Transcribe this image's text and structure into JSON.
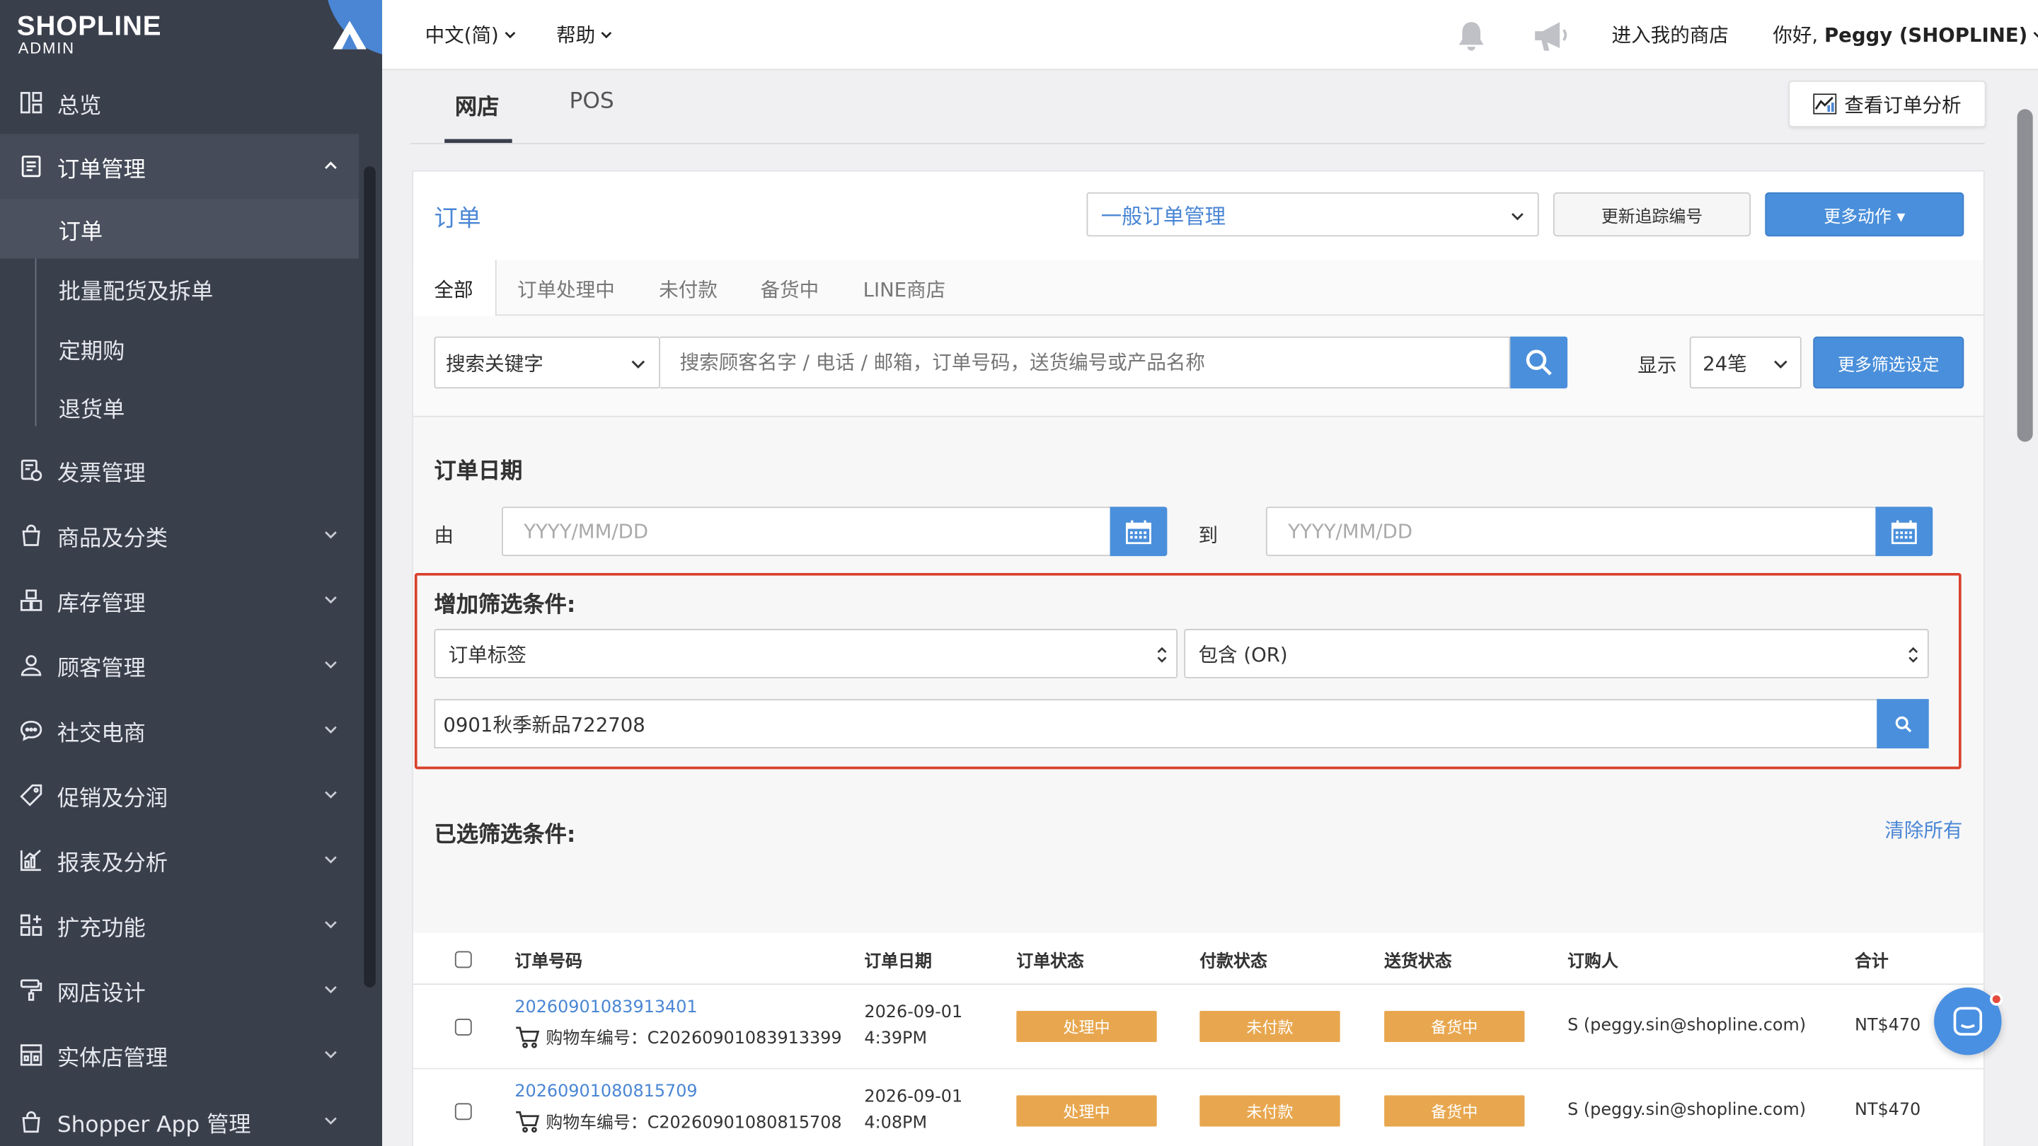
{
  "brand": {
    "logo_main": "SHOPLINE",
    "logo_sub": "ADMIN"
  },
  "sidebar": {
    "items": [
      {
        "label": "总览",
        "icon": "dashboard-icon"
      },
      {
        "label": "订单管理",
        "icon": "orders-icon",
        "expanded": true
      },
      {
        "label": "发票管理",
        "icon": "invoice-icon"
      },
      {
        "label": "商品及分类",
        "icon": "bag-icon"
      },
      {
        "label": "库存管理",
        "icon": "inventory-icon"
      },
      {
        "label": "顾客管理",
        "icon": "user-icon"
      },
      {
        "label": "社交电商",
        "icon": "chat-bubble-icon"
      },
      {
        "label": "促销及分润",
        "icon": "tag-icon"
      },
      {
        "label": "报表及分析",
        "icon": "chart-icon"
      },
      {
        "label": "扩充功能",
        "icon": "apps-icon"
      },
      {
        "label": "网店设计",
        "icon": "paint-icon"
      },
      {
        "label": "实体店管理",
        "icon": "store-icon"
      },
      {
        "label": "Shopper App 管理",
        "icon": "mobile-icon"
      }
    ],
    "sub_items": [
      {
        "label": "订单",
        "active": true
      },
      {
        "label": "批量配货及拆单"
      },
      {
        "label": "定期购"
      },
      {
        "label": "退货单"
      }
    ]
  },
  "topbar": {
    "language": "中文(简)",
    "help": "帮助",
    "enter_store": "进入我的商店",
    "greeting_prefix": "你好, ",
    "user_name": "Peggy (SHOPLINE)"
  },
  "page_tabs": [
    {
      "label": "网店",
      "active": true
    },
    {
      "label": "POS"
    }
  ],
  "analysis_button": "查看订单分析",
  "orders_panel": {
    "title": "订单",
    "management_select": "一般订单管理",
    "update_tracking_button": "更新追踪编号",
    "more_actions_button": "更多动作 ▾",
    "status_tabs": [
      "全部",
      "订单处理中",
      "未付款",
      "备货中",
      "LINE商店"
    ],
    "search": {
      "type_select": "搜索关键字",
      "placeholder": "搜索顾客名字 / 电话 / 邮箱，订单号码，送货编号或产品名称",
      "display_label": "显示",
      "per_page": "24笔",
      "more_filters_button": "更多筛选设定"
    },
    "date_filter": {
      "title": "订单日期",
      "from_label": "由",
      "to_label": "到",
      "from_placeholder": "YYYY/MM/DD",
      "to_placeholder": "YYYY/MM/DD"
    },
    "add_filter": {
      "title": "增加筛选条件:",
      "field_select": "订单标签",
      "operator_select": "包含 (OR)",
      "value": "0901秋季新品722708"
    },
    "chosen_filters": {
      "title": "已选筛选条件:",
      "clear_all": "清除所有"
    },
    "table": {
      "headers": [
        "订单号码",
        "订单日期",
        "订单状态",
        "付款状态",
        "送货状态",
        "订购人",
        "合计"
      ],
      "rows": [
        {
          "order_no": "20260901083913401",
          "cart_label": "购物车编号：C20260901083913399",
          "date": "2026-09-01",
          "time": "4:39PM",
          "order_status": "处理中",
          "payment_status": "未付款",
          "delivery_status": "备货中",
          "customer": "S (peggy.sin@shopline.com)",
          "total": "NT$470"
        },
        {
          "order_no": "20260901080815709",
          "cart_label": "购物车编号：C20260901080815708",
          "date": "2026-09-01",
          "time": "4:08PM",
          "order_status": "处理中",
          "payment_status": "未付款",
          "delivery_status": "备货中",
          "customer": "S (peggy.sin@shopline.com)",
          "total": "NT$470"
        }
      ]
    }
  },
  "colors": {
    "sidebar_bg": "#3a3f4c",
    "accent_blue": "#4a8fdb",
    "link_blue": "#4a86d4",
    "status_orange": "#e8a74f",
    "highlight_red": "#d9412d"
  }
}
